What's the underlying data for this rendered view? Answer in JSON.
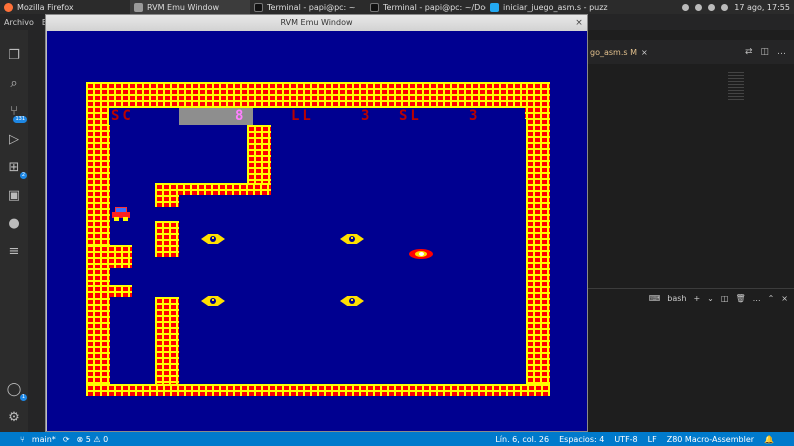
{
  "taskbar": {
    "tasks": [
      {
        "label": "Mozilla Firefox",
        "icon": "firefox-icon",
        "color": "#ff7139"
      },
      {
        "label": "RVM Emu Window",
        "icon": "window-icon",
        "color": "#9a9a9a"
      },
      {
        "label": "Terminal - papi@pc: ~",
        "icon": "terminal-icon",
        "color": "#111111"
      },
      {
        "label": "Terminal - papi@pc: ~/Docu...",
        "icon": "terminal-icon",
        "color": "#111111"
      },
      {
        "label": "iniciar_juego_asm.s - puzzle ...",
        "icon": "vscode-icon",
        "color": "#23a9f2"
      }
    ],
    "clock": "17 ago, 17:55"
  },
  "vscode": {
    "menu": [
      "Archivo",
      "Ed"
    ],
    "activity_badges": {
      "source_control": "131",
      "extensions": "2",
      "accounts": "1"
    },
    "editor_tab": "go_asm.s M",
    "terminal": {
      "shell": "bash"
    }
  },
  "statusbar": {
    "branch": "main*",
    "problems": "⊗ 5 ⚠ 0",
    "position": "Lín. 6, col. 26",
    "spaces": "Espacios: 4",
    "encoding": "UTF-8",
    "eol": "LF",
    "language": "Z80 Macro-Assembler"
  },
  "emulator": {
    "title": "RVM Emu Window",
    "hud": {
      "score_label": "SC",
      "lives_value": "8",
      "level_label": "LL",
      "level_value": "3",
      "stage_label": "SL",
      "stage_value": "3"
    },
    "colors": {
      "background": "#000090",
      "brick": "#ff0000",
      "mortar": "#ffff00"
    }
  }
}
